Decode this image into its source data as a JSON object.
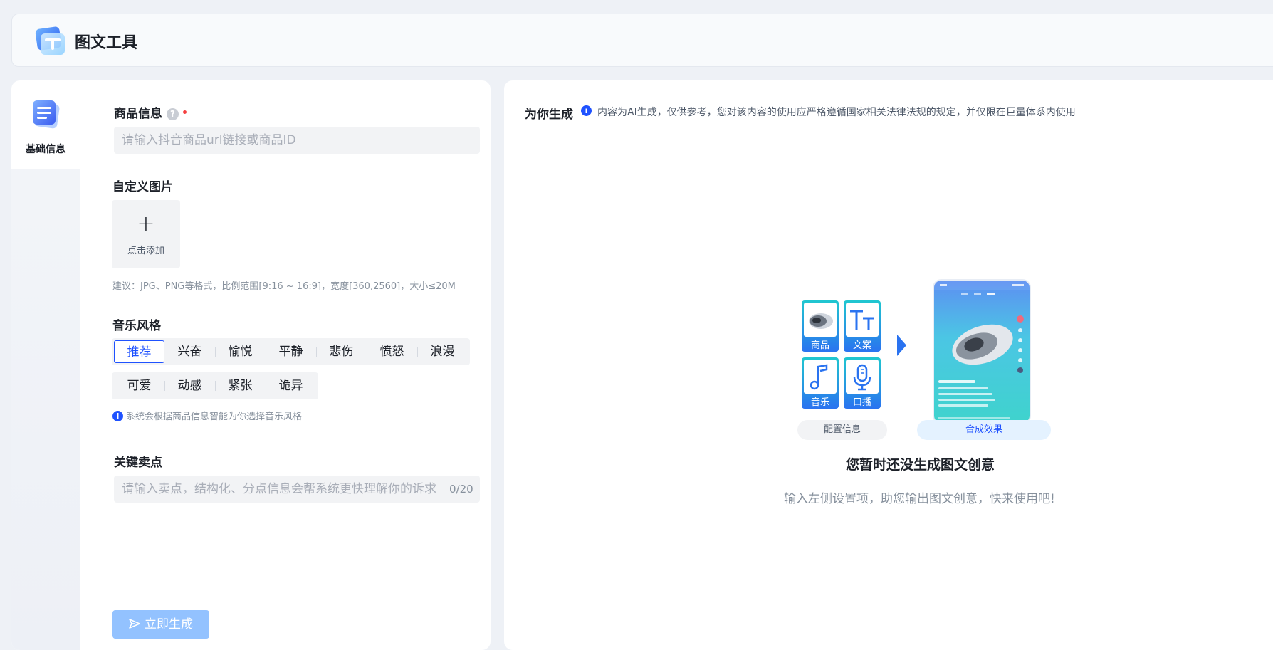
{
  "header": {
    "title": "图文工具"
  },
  "sidebar": {
    "items": [
      {
        "label": "基础信息"
      }
    ]
  },
  "form": {
    "product": {
      "label": "商品信息",
      "help": "?",
      "placeholder": "请输入抖音商品url链接或商品ID"
    },
    "custom_image": {
      "label": "自定义图片",
      "upload_plus": "+",
      "upload_label": "点击添加",
      "hint": "建议：JPG、PNG等格式，比例范围[9:16 ~ 16:9]，宽度[360,2560]，大小≤20M"
    },
    "music": {
      "label": "音乐风格",
      "selected": "推荐",
      "row1": [
        "推荐",
        "兴奋",
        "愉悦",
        "平静",
        "悲伤",
        "愤怒",
        "浪漫"
      ],
      "row2": [
        "可爱",
        "动感",
        "紧张",
        "诡异"
      ],
      "info_icon": "i",
      "hint": "系统会根据商品信息智能为你选择音乐风格"
    },
    "selling_points": {
      "label": "关键卖点",
      "placeholder": "请输入卖点，结构化、分点信息会帮系统更快理解你的诉求",
      "counter": "0/20"
    },
    "generate_button": "立即生成"
  },
  "result": {
    "title": "为你生成",
    "info_icon": "i",
    "disclaimer": "内容为AI生成，仅供参考，您对该内容的使用应严格遵循国家相关法律法规的规定，并仅限在巨量体系内使用",
    "illustration": {
      "tiles": [
        "商品",
        "文案",
        "音乐",
        "口播"
      ],
      "config_label": "配置信息",
      "result_label": "合成效果"
    },
    "empty_title": "您暂时还没生成图文创意",
    "empty_subtitle": "输入左侧设置项，助您输出图文创意，快来使用吧!"
  },
  "colors": {
    "accent": "#1f52ff",
    "button_disabled": "#93c2ff",
    "required": "#f53f3f",
    "tile_gradient_start": "#20c7d0",
    "tile_gradient_end": "#2a73f0"
  },
  "icons": [
    "app-logo-icon",
    "document-icon",
    "help-icon",
    "info-icon",
    "plus-icon",
    "send-icon",
    "product-icon",
    "text-icon",
    "music-icon",
    "microphone-icon",
    "arrow-right-icon"
  ]
}
